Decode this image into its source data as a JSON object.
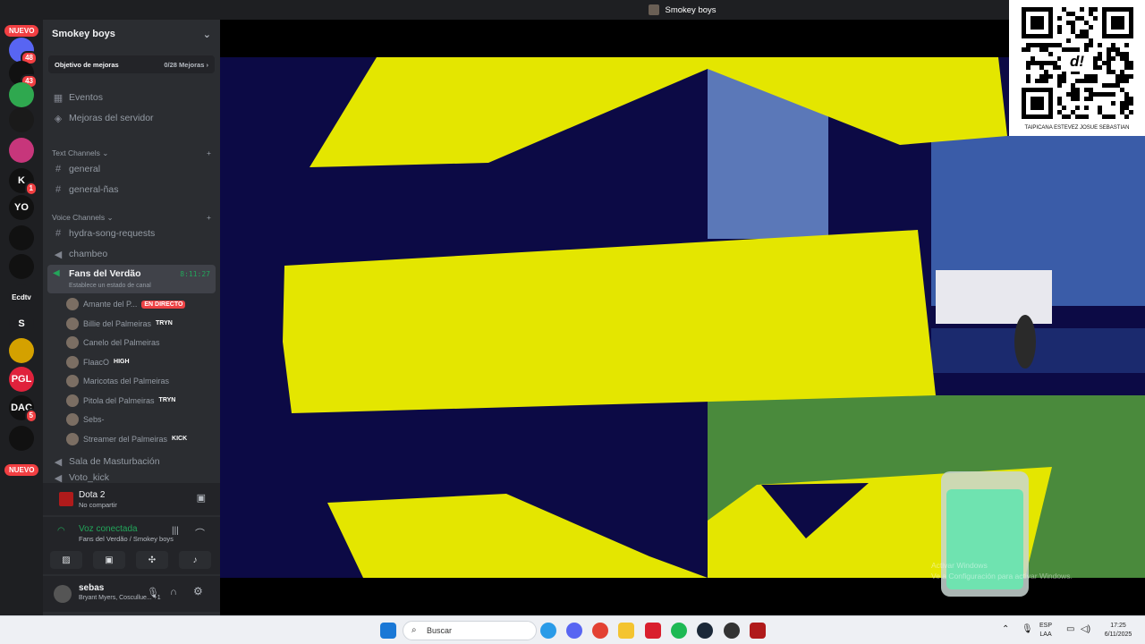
{
  "window": {
    "title": "Smokey boys"
  },
  "rail": {
    "nuevo_top": "NUEVO",
    "nuevo_bottom": "NUEVO",
    "servers": [
      {
        "name": "dm-avatar",
        "badge": "48",
        "color": "#5865f2",
        "text": ""
      },
      {
        "name": "server-rnr",
        "badge": "43",
        "color": "#111",
        "text": ""
      },
      {
        "name": "server-green",
        "badge": "",
        "color": "#2fa84f",
        "text": ""
      },
      {
        "name": "server-dark",
        "badge": "",
        "color": "#1a1a1a",
        "text": ""
      },
      {
        "name": "server-pink",
        "badge": "",
        "color": "#c7367b",
        "text": ""
      },
      {
        "name": "server-k",
        "badge": "1",
        "color": "#111",
        "text": "K"
      },
      {
        "name": "server-yolo",
        "badge": "",
        "color": "#111",
        "text": "YO"
      },
      {
        "name": "server-tp",
        "badge": "",
        "color": "#111",
        "text": ""
      },
      {
        "name": "server-ball",
        "badge": "",
        "color": "#111",
        "text": ""
      },
      {
        "name": "server-ecdtv",
        "badge": "",
        "color": "#1e1f22",
        "text": "Ecdtv"
      },
      {
        "name": "server-s",
        "badge": "",
        "color": "#1e1f22",
        "text": "S"
      },
      {
        "name": "server-yellow",
        "badge": "",
        "color": "#d4a100",
        "text": ""
      },
      {
        "name": "server-pgl",
        "badge": "",
        "color": "#e0223c",
        "text": "PGL"
      },
      {
        "name": "server-dac",
        "badge": "5",
        "color": "#111",
        "text": "DAC"
      },
      {
        "name": "server-wolf",
        "badge": "",
        "color": "#111",
        "text": ""
      }
    ]
  },
  "sidebar": {
    "server_name": "Smokey boys",
    "goal": {
      "label": "Objetivo de mejoras",
      "count": "0/28 Mejoras"
    },
    "events": "Eventos",
    "boosts": "Mejoras del servidor",
    "text_category": "Text Channels",
    "text_channels": [
      "general",
      "general-ñas"
    ],
    "voice_category": "Voice Channels",
    "voice_channels_top": [
      "hydra-song-requests",
      "chambeo"
    ],
    "active_channel": {
      "name": "Fans del Verdão",
      "timer": "8:11:27",
      "status": "Establece un estado de canal"
    },
    "voice_users": [
      {
        "name": "Amante del P...",
        "tag": "EN DIRECTO",
        "live": true
      },
      {
        "name": "Billie del Palmeiras",
        "tag": "TRYN",
        "live": false
      },
      {
        "name": "Canelo del Palmeiras",
        "tag": "",
        "live": false
      },
      {
        "name": "FlaacO",
        "tag": "HIGH",
        "live": false
      },
      {
        "name": "Maricotas del Palmeiras",
        "tag": "",
        "live": false
      },
      {
        "name": "Pitola del Palmeiras",
        "tag": "TRYN",
        "live": false
      },
      {
        "name": "Sebs-",
        "tag": "",
        "live": false
      },
      {
        "name": "Streamer del Palmeiras",
        "tag": "KICK",
        "live": false
      }
    ],
    "voice_channels_bottom": [
      "Sala de Masturbación",
      "Voto_kick"
    ]
  },
  "activity": {
    "game": "Dota 2",
    "sub": "No compartir"
  },
  "voice": {
    "status": "Voz conectada",
    "location": "Fans del Verdão / Smokey boys"
  },
  "user": {
    "name": "sebas",
    "activity": "Bryant Myers, Cosculluе... +1"
  },
  "stream": {
    "watermark_line1": "Activar Windows",
    "watermark_line2": "Ve a Configuración para activar Windows."
  },
  "qr": {
    "caption": "TAIPICANA ESTEVEZ JOSUE SEBASTIAN",
    "logo": "d!"
  },
  "taskbar": {
    "search_placeholder": "Buscar",
    "lang": "ESP",
    "region": "LAA",
    "time": "17:25",
    "date": "6/11/2025"
  },
  "colors": {
    "yellow": "#e4e600",
    "navy": "#0c0a45",
    "green": "#23a55a",
    "discord_bg": "#2b2d31"
  }
}
